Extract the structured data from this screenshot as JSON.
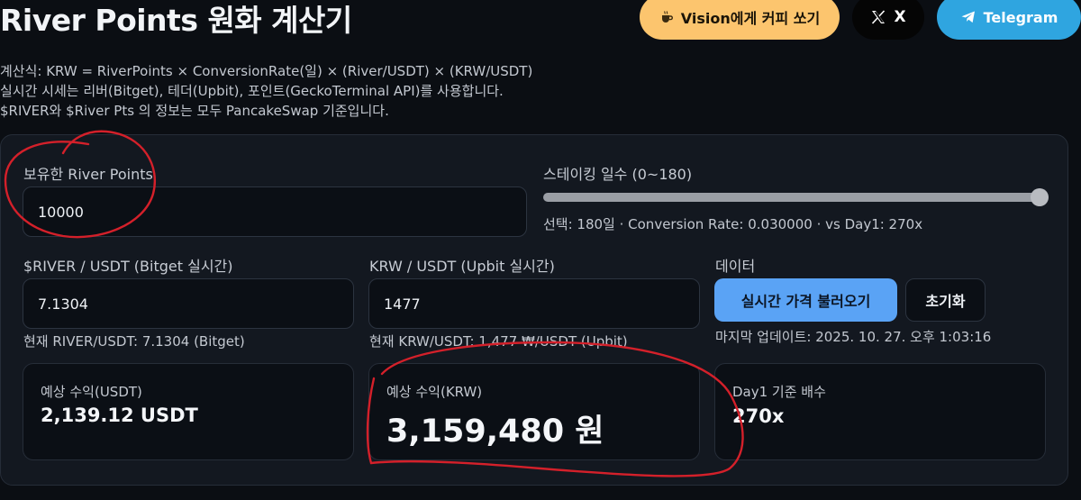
{
  "title": "River Points 원화 계산기",
  "header": {
    "coffee_label": "Vision에게 커피 쏘기",
    "x_label": "X",
    "telegram_label": "Telegram"
  },
  "formula": {
    "line1": "계산식: KRW = RiverPoints × ConversionRate(일) × (River/USDT) × (KRW/USDT)",
    "line2": "실시간 시세는 리버(Bitget), 테더(Upbit), 포인트(GeckoTerminal API)를 사용합니다.",
    "line3": "$RIVER와 $River Pts 의 정보는 모두 PancakeSwap 기준입니다."
  },
  "points": {
    "label": "보유한 River Points",
    "value": "10000"
  },
  "staking": {
    "label": "스테이킹 일수 (0~180)",
    "slider_fraction": 1.0,
    "selection_text": "선택: 180일 · Conversion Rate: 0.030000 · vs Day1: 270x"
  },
  "river_usdt": {
    "label": "$RIVER / USDT (Bitget 실시간)",
    "value": "7.1304",
    "current": "현재 RIVER/USDT: 7.1304 (Bitget)"
  },
  "krw_usdt": {
    "label": "KRW / USDT (Upbit 실시간)",
    "value": "1477",
    "current": "현재 KRW/USDT: 1,477 ₩/USDT (Upbit)"
  },
  "data_section": {
    "label": "데이터",
    "fetch_button": "실시간 가격 불러오기",
    "reset_button": "초기화",
    "last_update": "마지막 업데이트: 2025. 10. 27. 오후 1:03:16"
  },
  "results": {
    "usdt_label": "예상 수익(USDT)",
    "usdt_value": "2,139.12 USDT",
    "krw_label": "예상 수익(KRW)",
    "krw_value": "3,159,480 원",
    "multiplier_label": "Day1 기준 배수",
    "multiplier_value": "270x"
  },
  "colors": {
    "background": "#0b0e13",
    "panel": "#131820",
    "coffee_button": "#fcc56e",
    "telegram_button": "#2fa5e0",
    "primary_button": "#5aa3f5",
    "annotation_red": "#d4202a"
  },
  "icons": {
    "coffee": "coffee-icon",
    "x": "x-logo-icon",
    "telegram": "telegram-icon"
  }
}
